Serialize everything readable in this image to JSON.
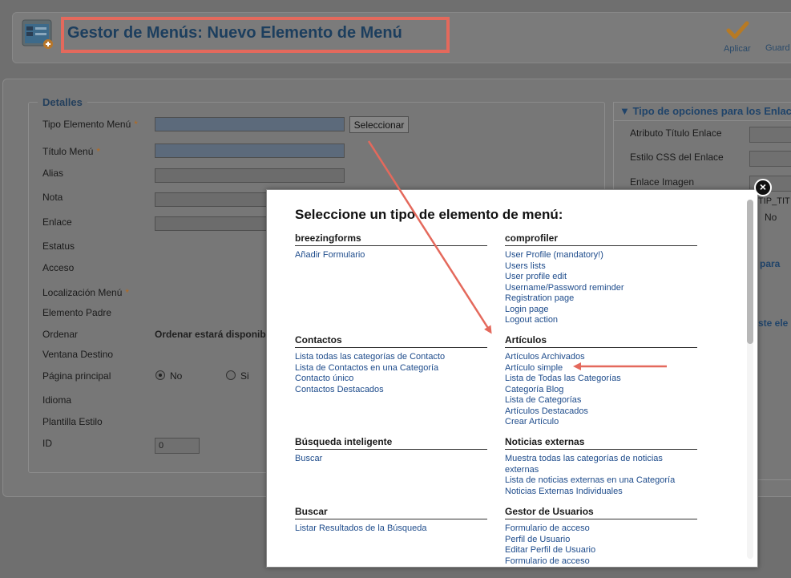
{
  "header": {
    "title": "Gestor de Menús: Nuevo Elemento de Menú",
    "apply_label": "Aplicar",
    "save_label": "Guard"
  },
  "details": {
    "legend": "Detalles",
    "labels": {
      "tipo": "Tipo Elemento Menú",
      "titulo": "Título Menú",
      "alias": "Alias",
      "nota": "Nota",
      "enlace": "Enlace",
      "estatus": "Estatus",
      "acceso": "Acceso",
      "localizacion": "Localización Menú",
      "padre": "Elemento Padre",
      "ordenar": "Ordenar",
      "ventana": "Ventana Destino",
      "pagina": "Página principal",
      "idioma": "Idioma",
      "plantilla": "Plantilla Estilo",
      "id": "ID"
    },
    "required_mark": "*",
    "select_button": "Seleccionar",
    "ordenar_text": "Ordenar estará disponible",
    "radio_no": "No",
    "radio_si": "Si",
    "id_value": "0"
  },
  "right_panel": {
    "title": "▼ Tipo de opciones para los Enlace",
    "labels": [
      "Atributo Título Enlace",
      "Estilo CSS del Enlace",
      "Enlace Imagen"
    ],
    "frag_tip": "TIP_TIT",
    "frag_no": "No",
    "frag_para": "para",
    "frag_ste": "ste ele"
  },
  "modal": {
    "title": "Seleccione un tipo de elemento de menú:",
    "close_label": "×",
    "categories": {
      "breezingforms": {
        "title": "breezingforms",
        "links": [
          "Añadir Formulario"
        ]
      },
      "comprofiler": {
        "title": "comprofiler",
        "links": [
          "User Profile (mandatory!)",
          "Users lists",
          "User profile edit",
          "Username/Password reminder",
          "Registration page",
          "Login page",
          "Logout action"
        ]
      },
      "contactos": {
        "title": "Contactos",
        "links": [
          "Lista todas las categorías de Contacto",
          "Lista de Contactos en una Categoría",
          "Contacto único",
          "Contactos Destacados"
        ]
      },
      "articulos": {
        "title": "Artículos",
        "links": [
          "Artículos Archivados",
          "Artículo simple",
          "Lista de Todas las Categorías",
          "Categoría Blog",
          "Lista de Categorías",
          "Artículos Destacados",
          "Crear Artículo"
        ]
      },
      "busqueda": {
        "title": "Búsqueda inteligente",
        "links": [
          "Buscar"
        ]
      },
      "noticias": {
        "title": "Noticias externas",
        "links": [
          "Muestra todas las categorías de noticias externas",
          "Lista de noticias externas en una Categoría",
          "Noticias Externas Individuales"
        ]
      },
      "buscar": {
        "title": "Buscar",
        "links": [
          "Listar Resultados de la Búsqueda"
        ]
      },
      "usuarios": {
        "title": "Gestor de Usuarios",
        "links": [
          "Formulario de acceso",
          "Perfil de Usuario",
          "Editar Perfil de Usuario",
          "Formulario de acceso"
        ]
      }
    }
  },
  "colors": {
    "annotation_red": "#e4695c",
    "link_blue": "#1d4b8b",
    "title_navy": "#1c3e5e"
  }
}
